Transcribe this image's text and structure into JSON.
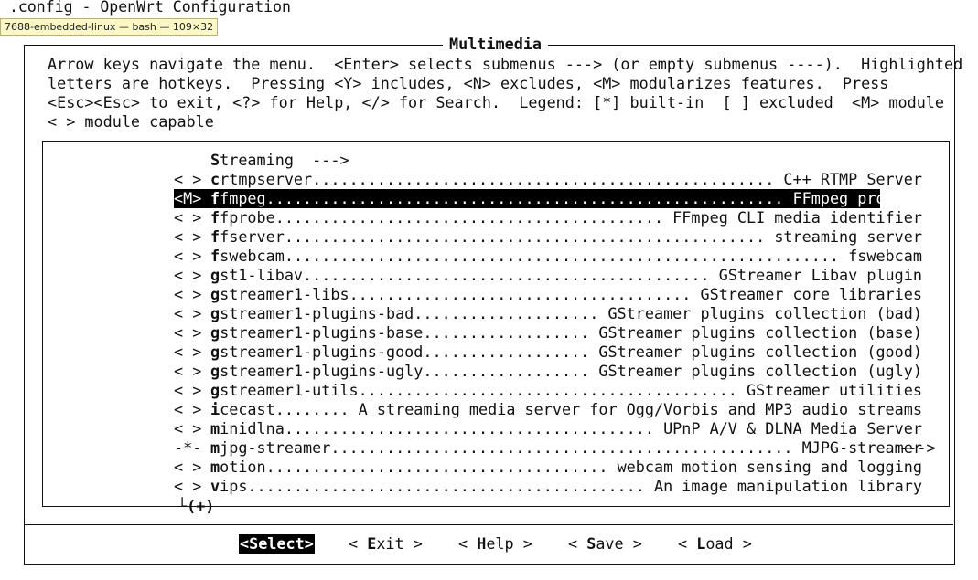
{
  "window": {
    "title": ".config - OpenWrt Configuration",
    "tooltip": "7688-embedded-linux — bash — 109×32"
  },
  "dialog": {
    "title": "Multimedia",
    "help_lines": [
      "Arrow keys navigate the menu.  <Enter> selects submenus ---> (or empty submenus ----).  Highlighted",
      "letters are hotkeys.  Pressing <Y> includes, <N> excludes, <M> modularizes features.  Press",
      "<Esc><Esc> to exit, <?> for Help, </> for Search.  Legend: [*] built-in  [ ] excluded  <M> module",
      "< > module capable"
    ]
  },
  "menu": {
    "items": [
      {
        "state": "   ",
        "hotkey": "S",
        "rest": "treaming  --->",
        "desc": ""
      },
      {
        "state": "< >",
        "hotkey": "c",
        "rest": "rtmpserver",
        "desc": "C++ RTMP Server"
      },
      {
        "state": "<M>",
        "hotkey": "f",
        "rest": "fmpeg",
        "desc": "FFmpeg program",
        "highlighted": true
      },
      {
        "state": "< >",
        "hotkey": "f",
        "rest": "fprobe",
        "desc": "FFmpeg CLI media identifier"
      },
      {
        "state": "< >",
        "hotkey": "f",
        "rest": "fserver",
        "desc": "streaming server"
      },
      {
        "state": "< >",
        "hotkey": "f",
        "rest": "swebcam",
        "desc": "fswebcam"
      },
      {
        "state": "< >",
        "hotkey": "g",
        "rest": "st1-libav",
        "desc": "GStreamer Libav plugin"
      },
      {
        "state": "< >",
        "hotkey": "g",
        "rest": "streamer1-libs",
        "desc": "GStreamer core libraries"
      },
      {
        "state": "< >",
        "hotkey": "g",
        "rest": "streamer1-plugins-bad",
        "desc": "GStreamer plugins collection (bad)"
      },
      {
        "state": "< >",
        "hotkey": "g",
        "rest": "streamer1-plugins-base",
        "desc": "GStreamer plugins collection (base)"
      },
      {
        "state": "< >",
        "hotkey": "g",
        "rest": "streamer1-plugins-good",
        "desc": "GStreamer plugins collection (good)"
      },
      {
        "state": "< >",
        "hotkey": "g",
        "rest": "streamer1-plugins-ugly",
        "desc": "GStreamer plugins collection (ugly)"
      },
      {
        "state": "< >",
        "hotkey": "g",
        "rest": "streamer1-utils",
        "desc": "GStreamer utilities"
      },
      {
        "state": "< >",
        "hotkey": "i",
        "rest": "cecast",
        "desc": "A streaming media server for Ogg/Vorbis and MP3 audio streams"
      },
      {
        "state": "< >",
        "hotkey": "m",
        "rest": "inidlna",
        "desc": "UPnP A/V & DLNA Media Server"
      },
      {
        "state": "-*-",
        "hotkey": "m",
        "rest": "jpg-streamer",
        "desc": "MJPG-streamer",
        "submenu": "  --->"
      },
      {
        "state": "< >",
        "hotkey": "m",
        "rest": "otion",
        "desc": "webcam motion sensing and logging"
      },
      {
        "state": "< >",
        "hotkey": "v",
        "rest": "ips",
        "desc": "An image manipulation library"
      }
    ],
    "more_indicator": "└(+)"
  },
  "buttons": {
    "select": "<Select>",
    "exit": "< Exit >",
    "help": "< Help >",
    "save": "< Save >",
    "load": "< Load >"
  }
}
